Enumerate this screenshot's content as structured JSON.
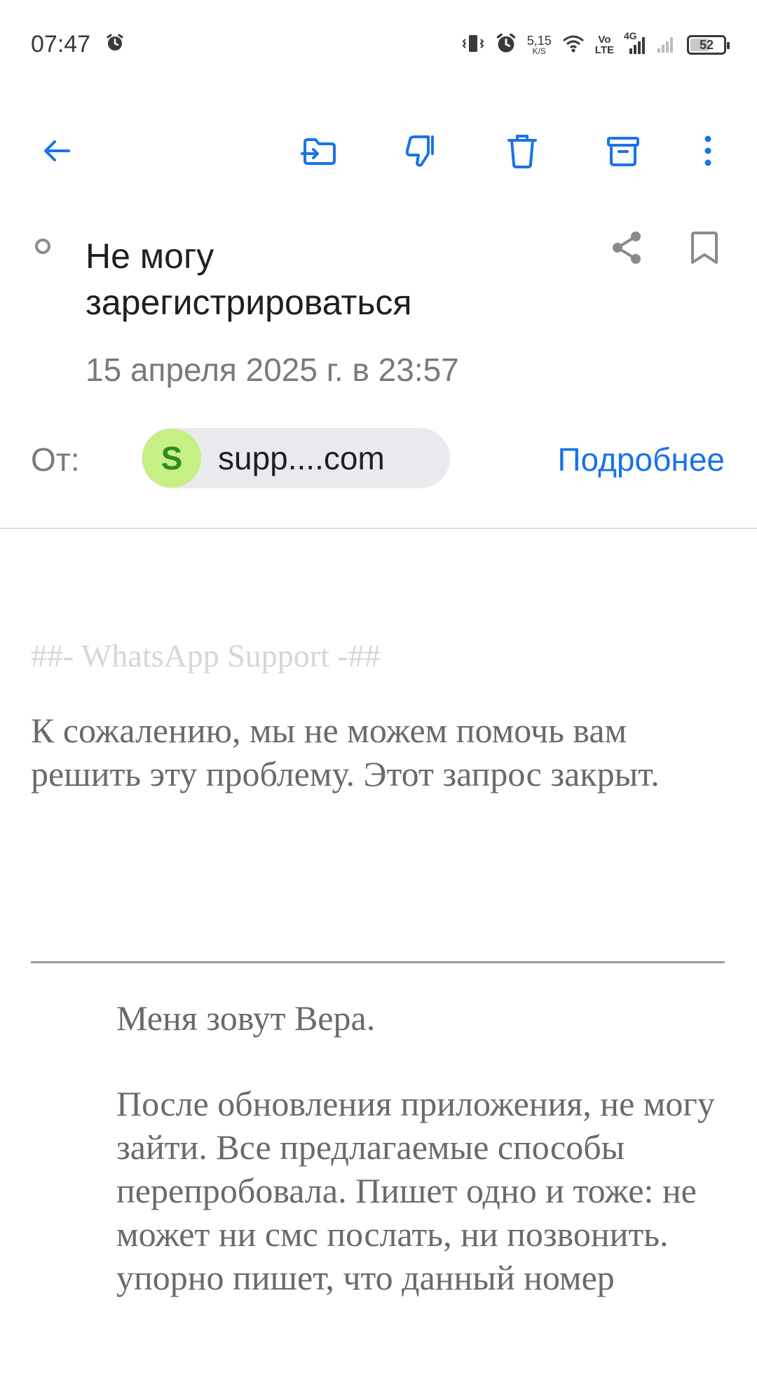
{
  "status_bar": {
    "time": "07:47",
    "net_speed_value": "5,15",
    "net_speed_unit": "K/S",
    "volte_top": "Vo",
    "volte_bottom": "LTE",
    "network_type": "4G",
    "battery_level": "52",
    "icons": [
      "alarm-icon",
      "vibrate-icon",
      "alarm-icon",
      "wifi-icon",
      "signal-icon",
      "signal-icon",
      "battery-icon"
    ]
  },
  "toolbar": {
    "icons": [
      "back-arrow-icon",
      "move-to-folder-icon",
      "spam-thumbs-down-icon",
      "trash-icon",
      "archive-icon",
      "more-vertical-icon"
    ]
  },
  "message": {
    "subject": "Не могу зарегистрироваться",
    "date": "15 апреля 2025 г. в 23:57",
    "from_label": "От:",
    "sender_initial": "S",
    "sender_name": "supp....com",
    "details_link": "Подробнее",
    "signature": "##- WhatsApp Support -##",
    "reply": "К сожалению, мы не можем помочь вам решить эту проблему. Этот запрос закрыт.",
    "quoted": [
      "Меня зовут Вера.",
      "После обновления приложения, не могу зайти. Все предлагаемые способы перепробовала. Пишет одно и тоже: не может ни смс послать, ни позвонить. упорно пишет, что данный номер"
    ]
  },
  "colors": {
    "accent": "#1a73e8",
    "avatar_bg": "#c6ef84",
    "avatar_text": "#2e8b20",
    "chip_bg": "#e8eaed"
  }
}
